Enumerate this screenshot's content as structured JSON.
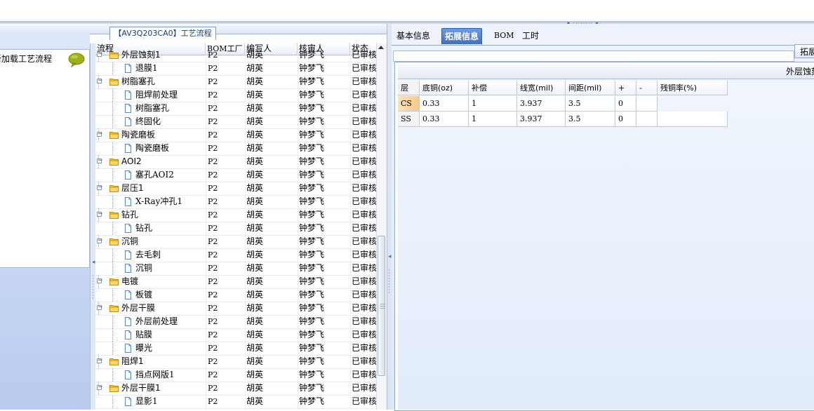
{
  "left_tab_caption": "【AV3Q203CA0】工艺流程",
  "left_panel": {
    "reload_label": "新加载工艺流程"
  },
  "grid": {
    "columns": [
      "流程",
      "BOM工厂",
      "编写人",
      "核审人",
      "状态"
    ],
    "rows": [
      {
        "name": "外层蚀刻1",
        "level": 1,
        "type": "folder",
        "bom": "P2",
        "writer": "胡英",
        "reviewer": "钟梦飞",
        "status": "已审核"
      },
      {
        "name": "退膜1",
        "level": 2,
        "type": "leaf",
        "bom": "P2",
        "writer": "胡英",
        "reviewer": "钟梦飞",
        "status": "已审核"
      },
      {
        "name": "树脂塞孔",
        "level": 1,
        "type": "folder",
        "bom": "P2",
        "writer": "胡英",
        "reviewer": "钟梦飞",
        "status": "已审核"
      },
      {
        "name": "阻焊前处理",
        "level": 2,
        "type": "leaf",
        "bom": "P2",
        "writer": "胡英",
        "reviewer": "钟梦飞",
        "status": "已审核"
      },
      {
        "name": "树脂塞孔",
        "level": 2,
        "type": "leaf",
        "bom": "P2",
        "writer": "胡英",
        "reviewer": "钟梦飞",
        "status": "已审核"
      },
      {
        "name": "终固化",
        "level": 2,
        "type": "leaf",
        "bom": "P2",
        "writer": "胡英",
        "reviewer": "钟梦飞",
        "status": "已审核"
      },
      {
        "name": "陶瓷磨板",
        "level": 1,
        "type": "folder",
        "bom": "P2",
        "writer": "胡英",
        "reviewer": "钟梦飞",
        "status": "已审核"
      },
      {
        "name": "陶瓷磨板",
        "level": 2,
        "type": "leaf",
        "bom": "P2",
        "writer": "胡英",
        "reviewer": "钟梦飞",
        "status": "已审核"
      },
      {
        "name": "AOI2",
        "level": 1,
        "type": "folder",
        "bom": "P2",
        "writer": "胡英",
        "reviewer": "钟梦飞",
        "status": "已审核"
      },
      {
        "name": "塞孔AOI2",
        "level": 2,
        "type": "leaf",
        "bom": "P2",
        "writer": "胡英",
        "reviewer": "钟梦飞",
        "status": "已审核"
      },
      {
        "name": "层压1",
        "level": 1,
        "type": "folder",
        "bom": "P2",
        "writer": "胡英",
        "reviewer": "钟梦飞",
        "status": "已审核"
      },
      {
        "name": "X-Ray冲孔1",
        "level": 2,
        "type": "leaf",
        "bom": "P2",
        "writer": "胡英",
        "reviewer": "钟梦飞",
        "status": "已审核"
      },
      {
        "name": "钻孔",
        "level": 1,
        "type": "folder",
        "bom": "P2",
        "writer": "胡英",
        "reviewer": "钟梦飞",
        "status": "已审核"
      },
      {
        "name": "钻孔",
        "level": 2,
        "type": "leaf",
        "bom": "P2",
        "writer": "胡英",
        "reviewer": "钟梦飞",
        "status": "已审核"
      },
      {
        "name": "沉铜",
        "level": 1,
        "type": "folder",
        "bom": "P2",
        "writer": "胡英",
        "reviewer": "钟梦飞",
        "status": "已审核"
      },
      {
        "name": "去毛刺",
        "level": 2,
        "type": "leaf",
        "bom": "P2",
        "writer": "胡英",
        "reviewer": "钟梦飞",
        "status": "已审核"
      },
      {
        "name": "沉铜",
        "level": 2,
        "type": "leaf",
        "bom": "P2",
        "writer": "胡英",
        "reviewer": "钟梦飞",
        "status": "已审核"
      },
      {
        "name": "电镀",
        "level": 1,
        "type": "folder",
        "bom": "P2",
        "writer": "胡英",
        "reviewer": "钟梦飞",
        "status": "已审核"
      },
      {
        "name": "板镀",
        "level": 2,
        "type": "leaf",
        "bom": "P2",
        "writer": "胡英",
        "reviewer": "钟梦飞",
        "status": "已审核"
      },
      {
        "name": "外层干膜",
        "level": 1,
        "type": "folder",
        "bom": "P2",
        "writer": "胡英",
        "reviewer": "钟梦飞",
        "status": "已审核"
      },
      {
        "name": "外层前处理",
        "level": 2,
        "type": "leaf",
        "bom": "P2",
        "writer": "胡英",
        "reviewer": "钟梦飞",
        "status": "已审核"
      },
      {
        "name": "贴膜",
        "level": 2,
        "type": "leaf",
        "bom": "P2",
        "writer": "胡英",
        "reviewer": "钟梦飞",
        "status": "已审核"
      },
      {
        "name": "曝光",
        "level": 2,
        "type": "leaf",
        "bom": "P2",
        "writer": "胡英",
        "reviewer": "钟梦飞",
        "status": "已审核"
      },
      {
        "name": "阻焊1",
        "level": 1,
        "type": "folder",
        "bom": "P2",
        "writer": "胡英",
        "reviewer": "钟梦飞",
        "status": "已审核"
      },
      {
        "name": "挡点网版1",
        "level": 2,
        "type": "leaf",
        "bom": "P2",
        "writer": "胡英",
        "reviewer": "钟梦飞",
        "status": "已审核"
      },
      {
        "name": "外层干膜1",
        "level": 1,
        "type": "folder",
        "bom": "P2",
        "writer": "胡英",
        "reviewer": "钟梦飞",
        "status": "已审核"
      },
      {
        "name": "显影1",
        "level": 2,
        "type": "leaf",
        "bom": "P2",
        "writer": "胡英",
        "reviewer": "钟梦飞",
        "status": "已审核"
      }
    ]
  },
  "right_panel": {
    "tabs": [
      {
        "label": "基本信息",
        "active": false
      },
      {
        "label": "拓展信息",
        "active": true
      },
      {
        "label": "BOM",
        "active": false
      },
      {
        "label": "工时",
        "active": false
      }
    ],
    "expand_button": "拓展",
    "caption": "外层蚀刻",
    "table": {
      "columns": [
        "层",
        "底铜(oz)",
        "补偿",
        "线宽(mil)",
        "间距(mil)",
        "+",
        "-",
        "残铜率(%)"
      ],
      "rows": [
        {
          "layer": "CS",
          "base_copper": "0.33",
          "compensation": "1",
          "line_width": "3.937",
          "spacing": "3.5",
          "plus": "0",
          "minus": "",
          "residual": ""
        },
        {
          "layer": "SS",
          "base_copper": "0.33",
          "compensation": "1",
          "line_width": "3.937",
          "spacing": "3.5",
          "plus": "0",
          "minus": "",
          "residual": ""
        }
      ]
    }
  }
}
